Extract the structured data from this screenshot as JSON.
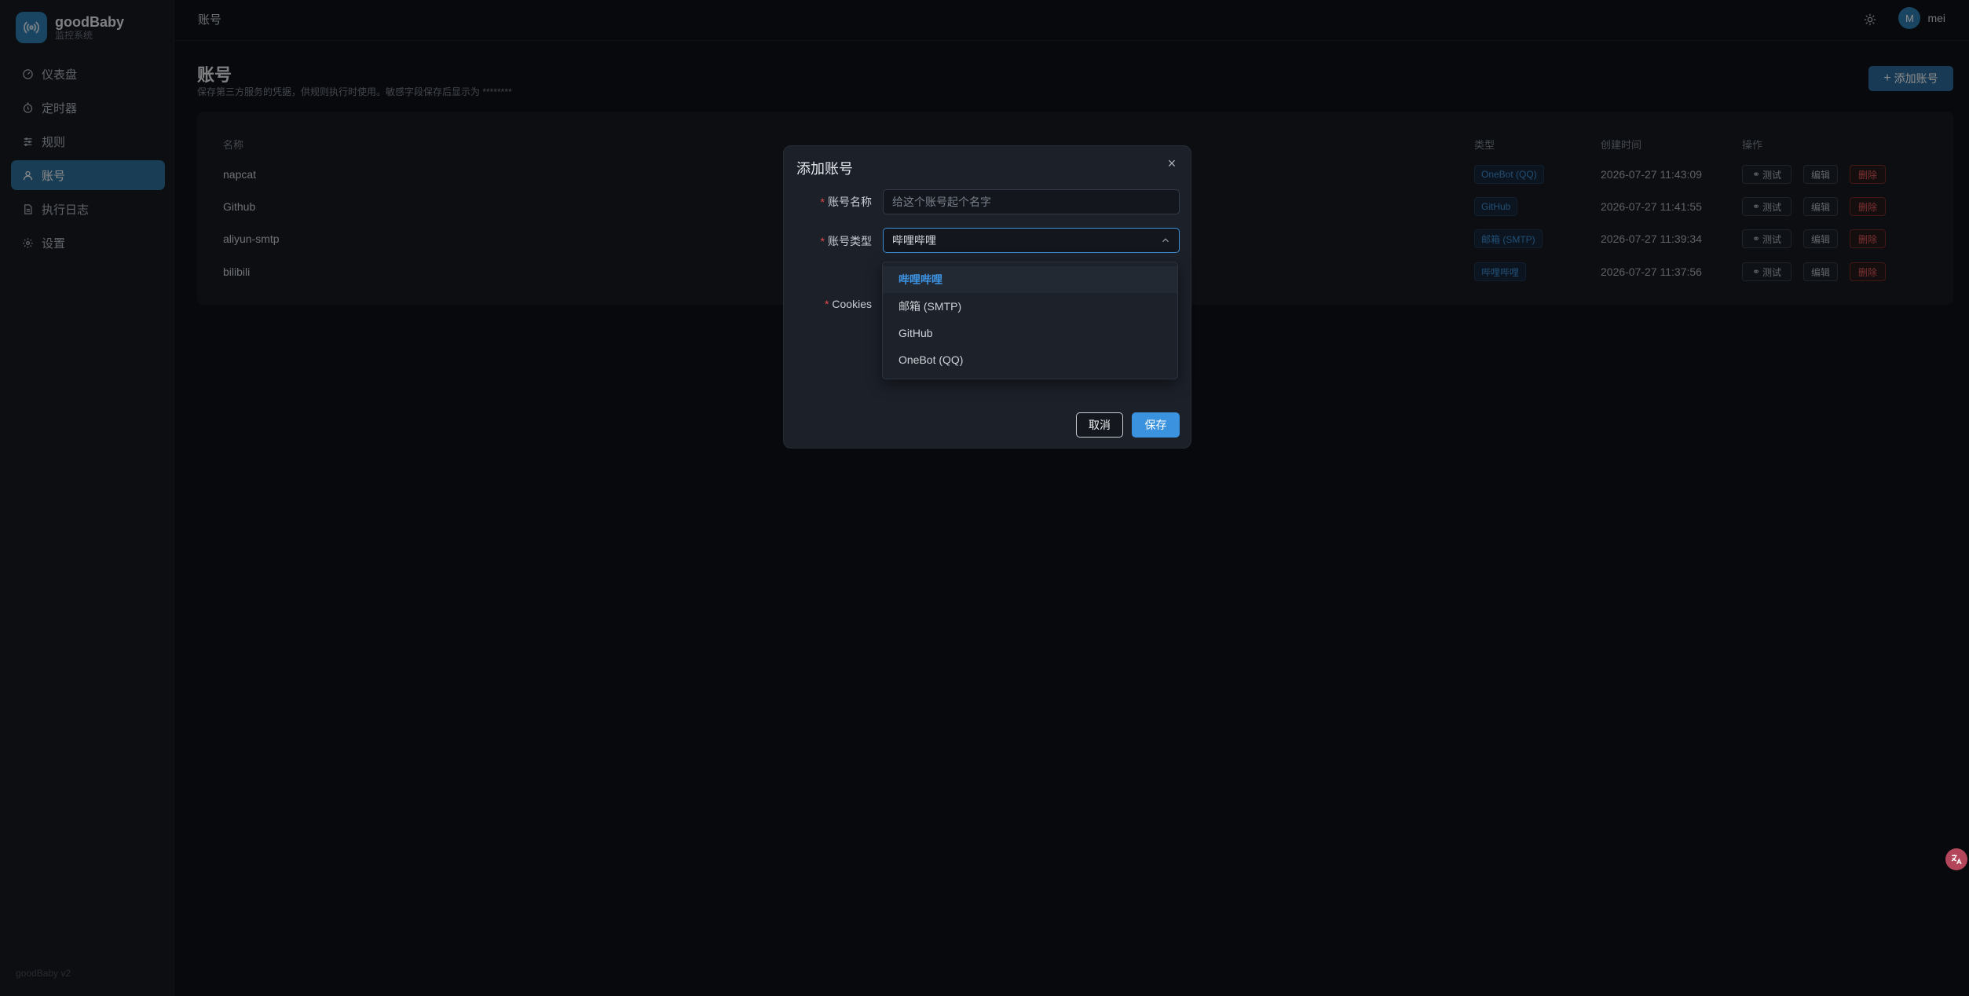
{
  "brand": {
    "name": "goodBaby",
    "subtitle": "监控系统"
  },
  "sidebar": {
    "items": [
      {
        "label": "仪表盘",
        "icon": "dashboard-icon"
      },
      {
        "label": "定时器",
        "icon": "timer-icon"
      },
      {
        "label": "规则",
        "icon": "sliders-icon"
      },
      {
        "label": "账号",
        "icon": "user-icon",
        "active": true
      },
      {
        "label": "执行日志",
        "icon": "log-icon"
      },
      {
        "label": "设置",
        "icon": "gear-icon"
      }
    ],
    "version": "goodBaby v2"
  },
  "topbar": {
    "breadcrumb": "账号",
    "user": {
      "initial": "M",
      "name": "mei"
    }
  },
  "page": {
    "title": "账号",
    "description": "保存第三方服务的凭据，供规则执行时使用。敏感字段保存后显示为 ********",
    "add_button": "添加账号"
  },
  "table": {
    "headers": {
      "name": "名称",
      "type": "类型",
      "created": "创建时间",
      "actions": "操作"
    },
    "rows": [
      {
        "name": "napcat",
        "type": "OneBot (QQ)",
        "created": "2026-07-27 11:43:09"
      },
      {
        "name": "Github",
        "type": "GitHub",
        "created": "2026-07-27 11:41:55"
      },
      {
        "name": "aliyun-smtp",
        "type": "邮箱 (SMTP)",
        "created": "2026-07-27 11:39:34"
      },
      {
        "name": "bilibili",
        "type": "哔哩哔哩",
        "created": "2026-07-27 11:37:56"
      }
    ],
    "actions": {
      "test": "测试",
      "edit": "编辑",
      "delete": "删除"
    }
  },
  "modal": {
    "title": "添加账号",
    "fields": {
      "name_label": "账号名称",
      "name_placeholder": "给这个账号起个名字",
      "type_label": "账号类型",
      "type_value": "哔哩哔哩",
      "cookies_label": "Cookies"
    },
    "cancel": "取消",
    "save": "保存"
  },
  "dropdown": {
    "options": [
      "哔哩哔哩",
      "邮箱 (SMTP)",
      "GitHub",
      "OneBot (QQ)"
    ],
    "selected": "哔哩哔哩"
  },
  "colors": {
    "accent": "#3b93e0",
    "danger": "#e45858",
    "active_nav": "#2f6f99"
  }
}
